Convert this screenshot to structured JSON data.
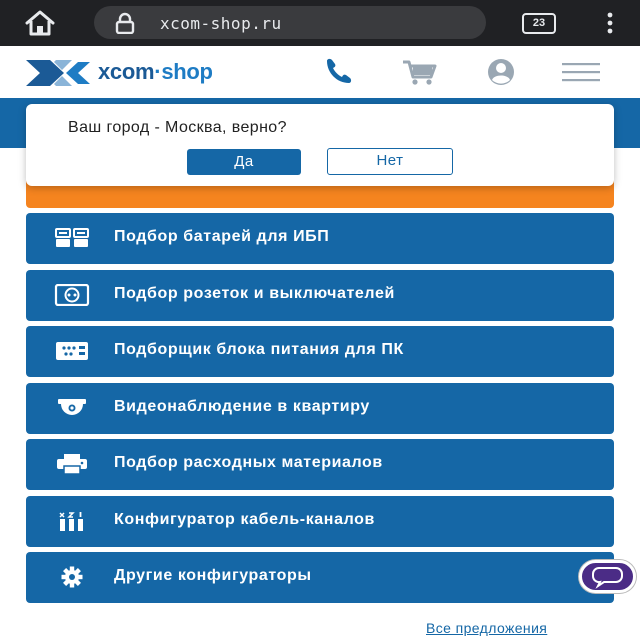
{
  "browser": {
    "url": "xcom-shop.ru",
    "tab_count": "23",
    "icons": [
      "home-icon",
      "lock-icon",
      "tabs-icon",
      "more-vert-icon"
    ]
  },
  "header": {
    "logo_word_1": "xcom",
    "logo_dot": "·",
    "logo_word_2": "shop",
    "icons": [
      "phone-icon",
      "cart-icon",
      "user-icon",
      "hamburger-icon"
    ],
    "brand_color": "#1567a6",
    "accent_orange": "#f5841f"
  },
  "city_popup": {
    "question": "Ваш город - Москва, верно?",
    "yes_label": "Да",
    "no_label": "Нет"
  },
  "configurators": [
    {
      "label": "Подбор батарей для ИБП",
      "icon": "battery-icon"
    },
    {
      "label": "Подбор розеток и выключателей",
      "icon": "socket-icon"
    },
    {
      "label": "Подборщик блока питания для ПК",
      "icon": "power-supply-icon"
    },
    {
      "label": "Видеонаблюдение в квартиру",
      "icon": "camera-icon"
    },
    {
      "label": "Подбор расходных материалов",
      "icon": "printer-icon"
    },
    {
      "label": "Конфигуратор кабель-каналов",
      "icon": "cable-channel-icon"
    },
    {
      "label": "Другие конфигураторы",
      "icon": "gear-icon"
    }
  ],
  "footer": {
    "all_offers_link": "Все предложения"
  }
}
